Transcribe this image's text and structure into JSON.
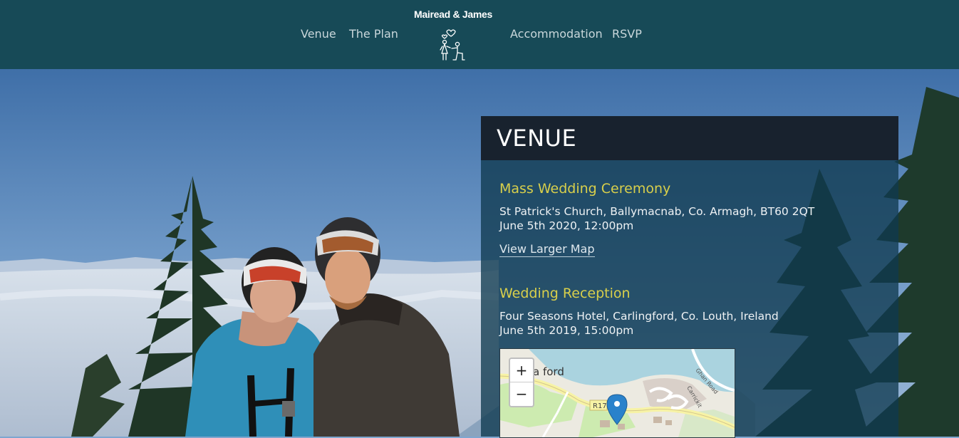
{
  "header": {
    "brand": "Mairead & James",
    "logo_icon": "couple-proposal-icon",
    "nav": {
      "venue": "Venue",
      "plan": "The Plan",
      "accommodation": "Accommodation",
      "rsvp": "RSVP"
    }
  },
  "venue": {
    "heading": "VENUE",
    "ceremony": {
      "title": "Mass Wedding Ceremony",
      "address": "St Patrick's Church, Ballymacnab, Co. Armagh, BT60 2QT",
      "datetime": "June 5th 2020, 12:00pm",
      "map_link": "View Larger Map"
    },
    "reception": {
      "title": "Wedding Reception",
      "address": "Four Seasons Hotel, Carlingford, Co. Louth, Ireland",
      "datetime": "June 5th 2019, 15:00pm"
    },
    "map": {
      "zoom_in": "+",
      "zoom_out": "−",
      "place_label": "a ford",
      "road_label": "R17",
      "street_label_1": "Ghan Road",
      "street_label_2": "Carrickit"
    }
  },
  "colors": {
    "header_bg": "#174a57",
    "panel_head_bg": "#18222e",
    "accent_yellow": "#d8cf4b",
    "nav_text": "#c9d7db"
  }
}
